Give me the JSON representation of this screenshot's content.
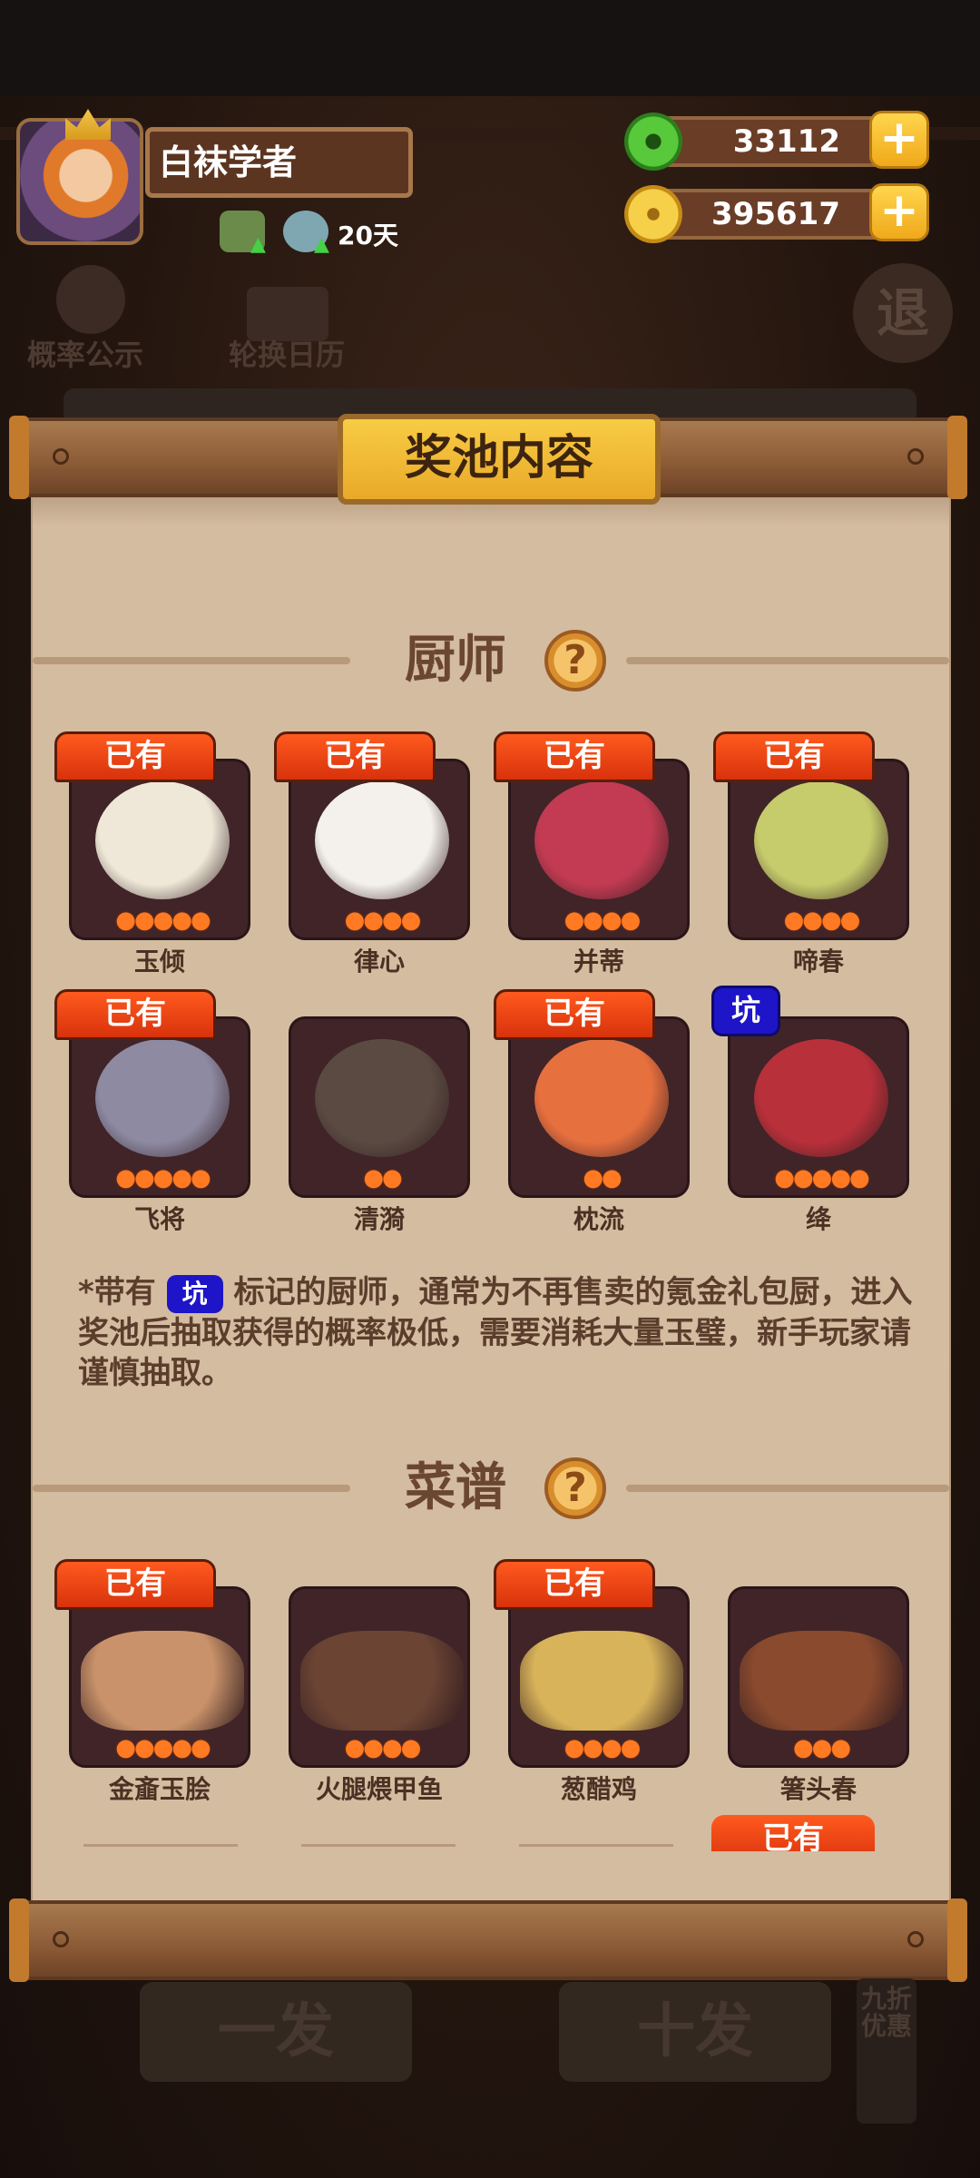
{
  "player": {
    "name": "白袜学者",
    "days": "20天"
  },
  "currency": {
    "jade": "33112",
    "coins": "395617",
    "plus": "+"
  },
  "behind": {
    "probability": "概率公示",
    "calendar": "轮换日历",
    "back": "退",
    "draw_one": "一发",
    "draw_ten": "十发",
    "discount": "九折优惠"
  },
  "panel": {
    "title": "奖池内容",
    "chef_section": "厨师",
    "recipe_section": "菜谱",
    "help": "?",
    "owned_label": "已有",
    "pit_label": "坑",
    "note_prefix": "*带有",
    "note_suffix": "标记的厨师，通常为不再售卖的氪金礼包厨，进入奖池后抽取获得的概率极低，需要消耗大量玉璧，新手玩家请谨慎抽取。"
  },
  "chefs": [
    {
      "name": "玉倾",
      "owned": true,
      "stars": 5,
      "color": "#efe8d8"
    },
    {
      "name": "律心",
      "owned": true,
      "stars": 4,
      "color": "#f4f1ec"
    },
    {
      "name": "并蒂",
      "owned": true,
      "stars": 4,
      "color": "#c23b52"
    },
    {
      "name": "啼春",
      "owned": true,
      "stars": 4,
      "color": "#c6cc6c"
    },
    {
      "name": "飞将",
      "owned": true,
      "stars": 5,
      "color": "#8d8aa2"
    },
    {
      "name": "清漪",
      "owned": false,
      "stars": 2,
      "color": "#5b4a42"
    },
    {
      "name": "枕流",
      "owned": true,
      "stars": 2,
      "color": "#e7703f"
    },
    {
      "name": "绛",
      "owned": false,
      "pit": true,
      "stars": 5,
      "color": "#b8303a"
    }
  ],
  "recipes": [
    {
      "name": "金齑玉脍",
      "owned": true,
      "stars": 5,
      "color": "#c9926a"
    },
    {
      "name": "火腿煨甲鱼",
      "owned": false,
      "stars": 4,
      "color": "#6b4434"
    },
    {
      "name": "葱醋鸡",
      "owned": true,
      "stars": 4,
      "color": "#d8b35a"
    },
    {
      "name": "箸头春",
      "owned": false,
      "stars": 3,
      "color": "#8a4a2e"
    }
  ],
  "icons": {
    "jade": "jade-disc-icon",
    "coin": "copper-coin-icon",
    "star": "flame-star-icon"
  }
}
